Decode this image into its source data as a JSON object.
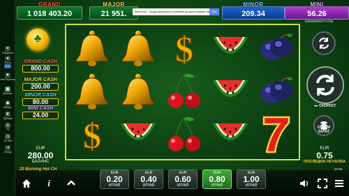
{
  "sidebar": {
    "items": [
      {
        "label": "Офферти",
        "icon": "gift-icon"
      },
      {
        "label": "Мъни",
        "icon": "coin-icon"
      },
      {
        "label": "Нов Игрални",
        "icon": "new-games-icon"
      },
      {
        "label": "Депозит",
        "icon": "wallet-icon"
      },
      {
        "label": "Мисии",
        "icon": "shield-icon"
      },
      {
        "label": "Турнири",
        "icon": "trophy-icon"
      },
      {
        "label": "Та",
        "icon": "chip-icon"
      },
      {
        "label": "Зи ней",
        "icon": "clock-icon"
      },
      {
        "label": "Изход",
        "icon": "exit-icon"
      }
    ],
    "badge": "678"
  },
  "jackpots": {
    "grand": {
      "label": "GRAND",
      "value": "1 018 403.20"
    },
    "major": {
      "label": "MAJOR",
      "value": "21 951."
    },
    "minor": {
      "label": "MINOR",
      "value": "209.34"
    },
    "mini": {
      "label": "MINI",
      "value": "56.26"
    }
  },
  "notice": {
    "text": "inbet.com - За да изпратите ст ржение на цяло екрана, натиснете",
    "button": "Esc"
  },
  "side_jackpots": {
    "grand_cash": {
      "label": "GRAND CASH",
      "value": "800.00"
    },
    "major_cash": {
      "label": "MAJOR CASH",
      "value": "200.00"
    },
    "minor_cash": {
      "label": "MINOR CASH",
      "value": "80.00"
    },
    "mini_cash": {
      "label": "MINI CASH",
      "value": "24.00"
    }
  },
  "reels": [
    [
      "bell",
      "bell",
      "dollar",
      "watermelon",
      "plum"
    ],
    [
      "bell",
      "bell",
      "cherries",
      "watermelon",
      "plum"
    ],
    [
      "dollar",
      "watermelon",
      "cherries",
      "watermelon",
      "seven"
    ]
  ],
  "reel_id": "8386609033771708",
  "balance": {
    "currency": "EUR",
    "value": "280.00",
    "label": "БАЛАНС"
  },
  "last_win": {
    "currency": "EUR",
    "value": "0.75",
    "label": "ПОСЛЕДНА ПЕЧАЛБА"
  },
  "right_controls": {
    "fast_label": "СКОРОСТ",
    "options_label": "ОПЦИИ",
    "options_label2": "ЗАЛОГ"
  },
  "clock": "20:05",
  "game_name": "20 Burning Hot CH",
  "bets": [
    {
      "currency": "EUR",
      "value": "0.20",
      "label": "ИГРАЙ",
      "active": false
    },
    {
      "currency": "EUR",
      "value": "0.40",
      "label": "ИГРАЙ",
      "active": false
    },
    {
      "currency": "EUR",
      "value": "0.60",
      "label": "ИГРАЙ",
      "active": false
    },
    {
      "currency": "EUR",
      "value": "0.80",
      "label": "ИГРАЙ",
      "active": true
    },
    {
      "currency": "EUR",
      "value": "1.00",
      "label": "ИГРАЙ",
      "active": false
    }
  ],
  "colors": {
    "reel_border": "#d2e040",
    "active_bet": "#3fa83a",
    "gold": "#ffd23a"
  }
}
